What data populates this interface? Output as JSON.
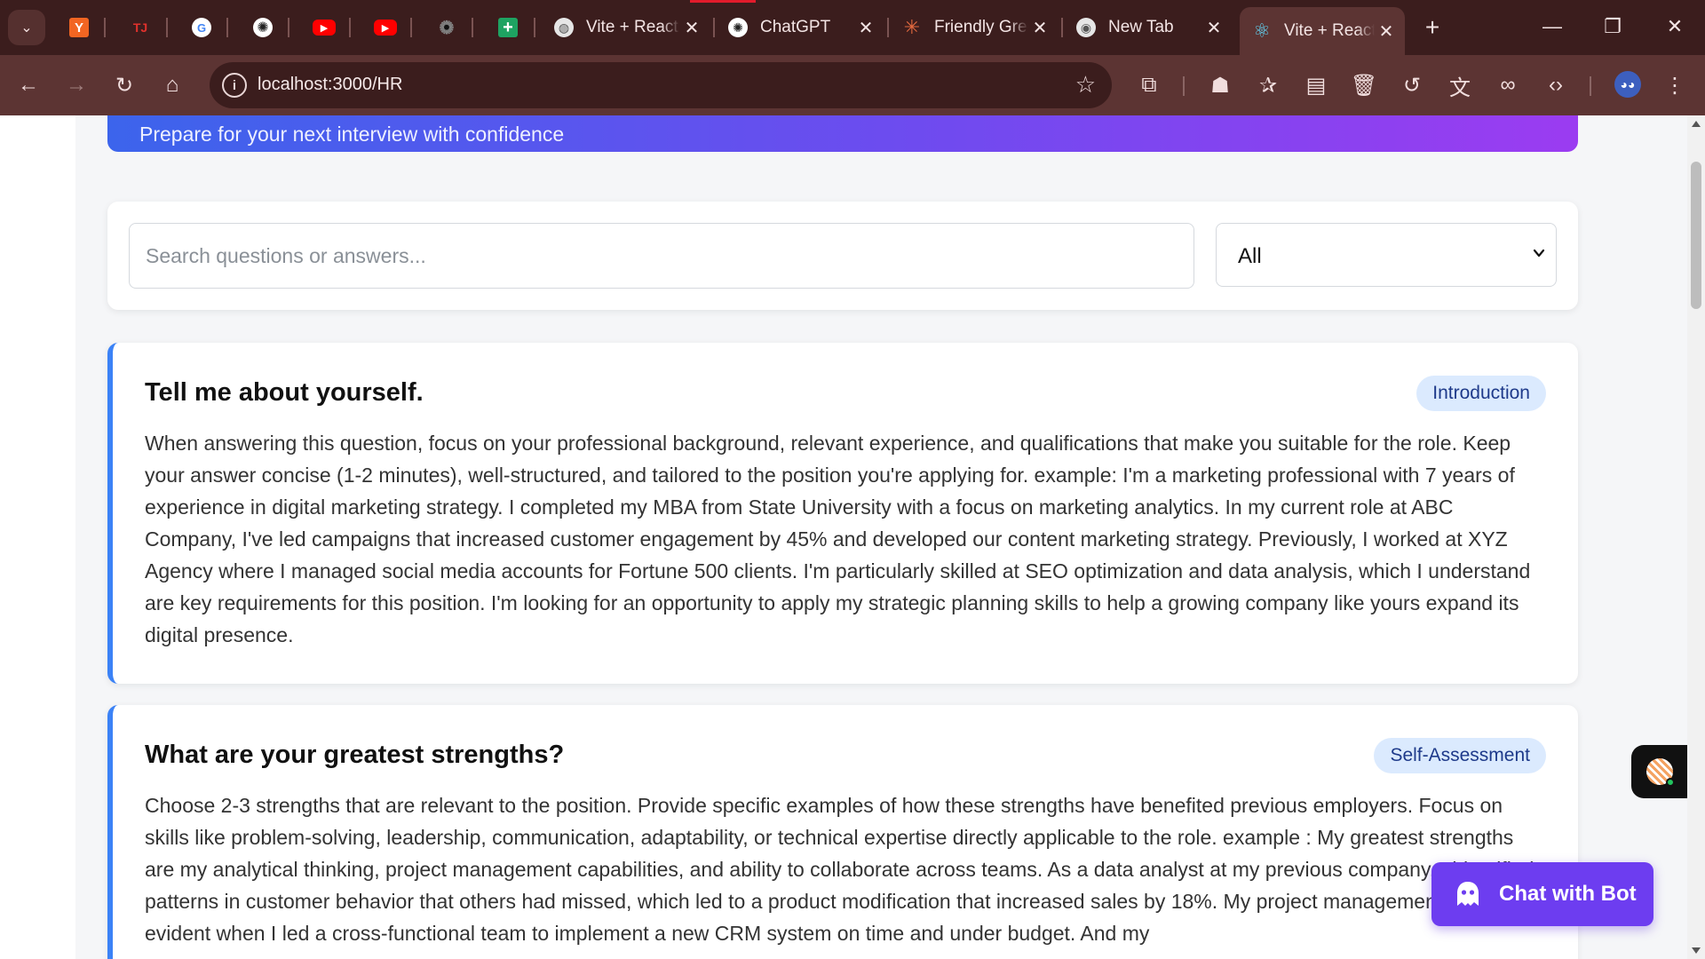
{
  "browser": {
    "pinned_tabs": [
      {
        "icon": "y-combinator-icon",
        "glyph": "Y",
        "color": "#f26522"
      },
      {
        "icon": "tj-icon",
        "glyph": "TJ",
        "color": "#e0312c"
      },
      {
        "icon": "google-icon",
        "glyph": "G",
        "color": "#ffffff"
      },
      {
        "icon": "openai-icon",
        "glyph": "✺",
        "color": "#ffffff"
      },
      {
        "icon": "youtube-icon",
        "glyph": "▶",
        "color": "#ff0000"
      },
      {
        "icon": "youtube-icon",
        "glyph": "▶",
        "color": "#ff0000"
      },
      {
        "icon": "openai-icon",
        "glyph": "✺",
        "color": "#111111"
      },
      {
        "icon": "google-sheets-icon",
        "glyph": "+",
        "color": "#1ea362"
      }
    ],
    "tabs": [
      {
        "title": "Vite + React",
        "icon": "globe-icon"
      },
      {
        "title": "ChatGPT",
        "icon": "openai-icon"
      },
      {
        "title": "Friendly Greeting",
        "icon": "claude-icon"
      },
      {
        "title": "New Tab",
        "icon": "chrome-icon"
      },
      {
        "title": "Vite + React",
        "icon": "react-icon"
      }
    ],
    "url": "localhost:3000/HR"
  },
  "page": {
    "hero_subtitle": "Prepare for your next interview with confidence",
    "search_placeholder": "Search questions or answers...",
    "category_selected": "All",
    "questions": [
      {
        "question": "Tell me about yourself.",
        "category": "Introduction",
        "answer": "When answering this question, focus on your professional background, relevant experience, and qualifications that make you suitable for the role. Keep your answer concise (1-2 minutes), well-structured, and tailored to the position you're applying for. example: I'm a marketing professional with 7 years of experience in digital marketing strategy. I completed my MBA from State University with a focus on marketing analytics. In my current role at ABC Company, I've led campaigns that increased customer engagement by 45% and developed our content marketing strategy. Previously, I worked at XYZ Agency where I managed social media accounts for Fortune 500 clients. I'm particularly skilled at SEO optimization and data analysis, which I understand are key requirements for this position. I'm looking for an opportunity to apply my strategic planning skills to help a growing company like yours expand its digital presence."
      },
      {
        "question": "What are your greatest strengths?",
        "category": "Self-Assessment",
        "answer": "Choose 2-3 strengths that are relevant to the position. Provide specific examples of how these strengths have benefited previous employers. Focus on skills like problem-solving, leadership, communication, adaptability, or technical expertise directly applicable to the role. example : My greatest strengths are my analytical thinking, project management capabilities, and ability to collaborate across teams. As a data analyst at my previous company, I identified patterns in customer behavior that others had missed, which led to a product modification that increased sales by 18%. My project management skills were evident when I led a cross-functional team to implement a new CRM system on time and under budget. And my"
      }
    ],
    "chat_button_label": "Chat with Bot"
  },
  "colors": {
    "accent_border": "#3b82f6",
    "badge_bg": "#dbeafe",
    "badge_text": "#1e3a8a",
    "chat_button": "#6d3df0",
    "hero_start": "#3c64ec",
    "hero_end": "#9b3cf1"
  }
}
